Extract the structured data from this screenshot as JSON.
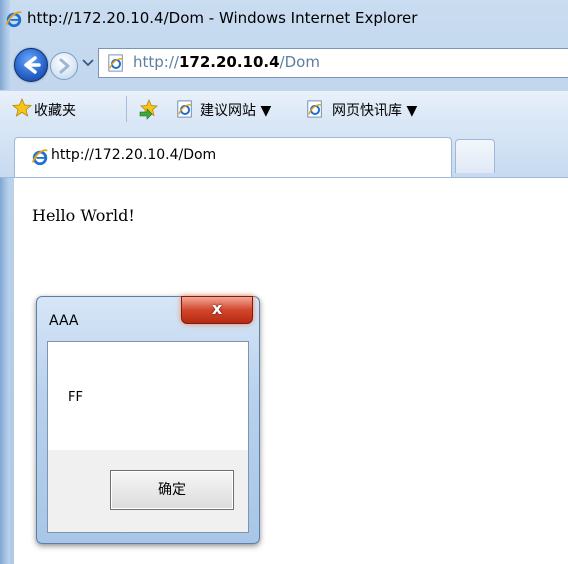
{
  "window": {
    "title": "http://172.20.10.4/Dom - Windows Internet Explorer"
  },
  "address_bar": {
    "prefix": "http://",
    "host": "172.20.10.4",
    "path": "/Dom"
  },
  "favorites_bar": {
    "favorites_label": "收藏夹",
    "links": [
      {
        "label": "建议网站 ▼",
        "icon": "ie-page-icon"
      },
      {
        "label": "网页快讯库 ▼",
        "icon": "ie-page-icon"
      }
    ]
  },
  "tabs": [
    {
      "label": "http://172.20.10.4/Dom",
      "active": true
    }
  ],
  "page": {
    "text": "Hello World!"
  },
  "dialog": {
    "title": "AAA",
    "message": "FF",
    "ok_label": "确定",
    "close_glyph": "x"
  },
  "colors": {
    "close_button": "#d2462c",
    "chrome_blue": "#b7cfe9"
  }
}
